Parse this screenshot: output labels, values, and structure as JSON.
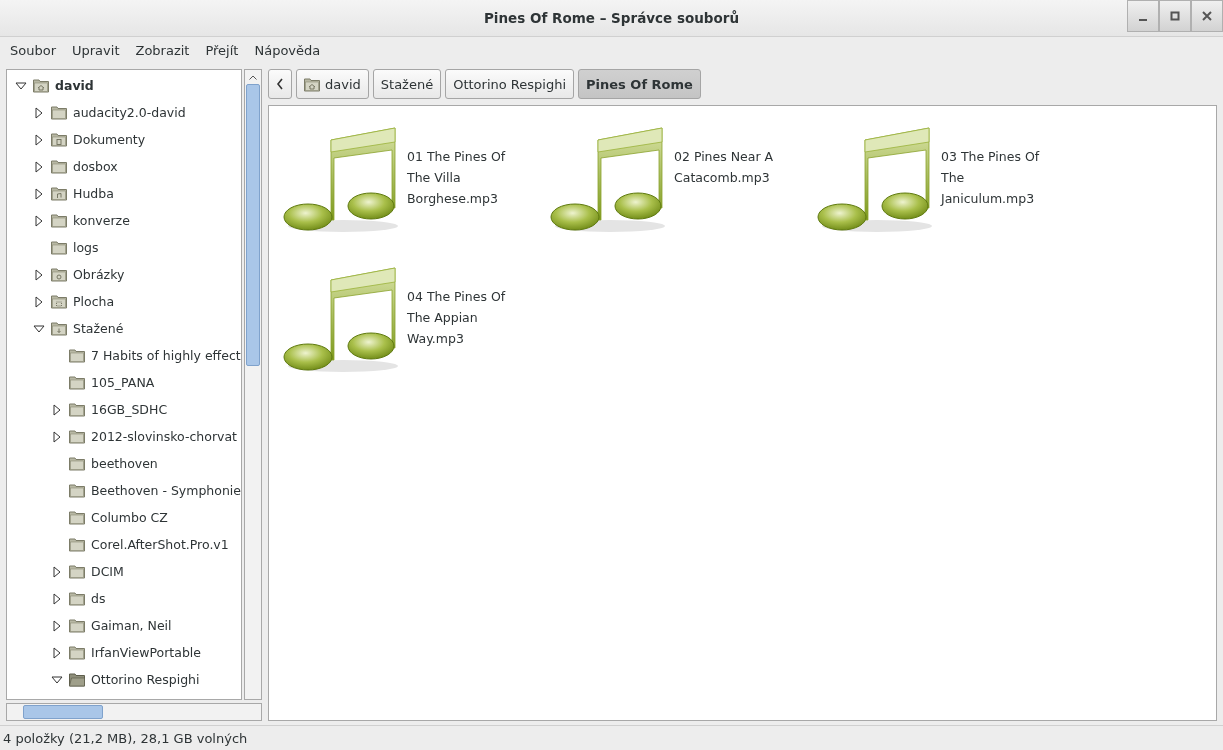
{
  "window": {
    "title": "Pines Of Rome – Správce souborů"
  },
  "menu": [
    "Soubor",
    "Upravit",
    "Zobrazit",
    "Přejít",
    "Nápověda"
  ],
  "sidebar": {
    "tree": [
      {
        "label": "david",
        "kind": "home",
        "expanded": true,
        "children": [
          {
            "label": "audacity2.0-david",
            "expanded": false
          },
          {
            "label": "Dokumenty",
            "kind": "documents",
            "expanded": false
          },
          {
            "label": "dosbox",
            "expanded": false
          },
          {
            "label": "Hudba",
            "kind": "music",
            "expanded": false
          },
          {
            "label": "konverze",
            "expanded": false
          },
          {
            "label": "logs"
          },
          {
            "label": "Obrázky",
            "kind": "pictures",
            "expanded": false
          },
          {
            "label": "Plocha",
            "kind": "desktop",
            "expanded": false
          },
          {
            "label": "Stažené",
            "kind": "downloads",
            "expanded": true,
            "children": [
              {
                "label": "7 Habits of highly effect"
              },
              {
                "label": "105_PANA"
              },
              {
                "label": "16GB_SDHC",
                "expanded": false
              },
              {
                "label": "2012-slovinsko-chorvat",
                "expanded": false
              },
              {
                "label": "beethoven"
              },
              {
                "label": "Beethoven - Symphonie"
              },
              {
                "label": "Columbo CZ"
              },
              {
                "label": "Corel.AfterShot.Pro.v1"
              },
              {
                "label": "DCIM",
                "expanded": false
              },
              {
                "label": "ds",
                "expanded": false
              },
              {
                "label": "Gaiman, Neil",
                "expanded": false
              },
              {
                "label": "IrfanViewPortable",
                "expanded": false
              },
              {
                "label": "Ottorino Respighi",
                "kind": "open",
                "expanded": true
              }
            ]
          }
        ]
      }
    ]
  },
  "breadcrumbs": [
    {
      "label": "david",
      "kind": "home",
      "selected": false
    },
    {
      "label": "Stažené",
      "selected": false
    },
    {
      "label": "Ottorino Respighi",
      "selected": false
    },
    {
      "label": "Pines Of Rome",
      "selected": true
    }
  ],
  "files": [
    {
      "name": "01 The Pines Of The Villa Borghese.mp3"
    },
    {
      "name": "02 Pines Near A Catacomb.mp3"
    },
    {
      "name": "03 The Pines Of The Janiculum.mp3"
    },
    {
      "name": "04 The Pines Of The Appian Way.mp3"
    }
  ],
  "status_bar": "4 položky (21,2 MB), 28,1 GB volných"
}
